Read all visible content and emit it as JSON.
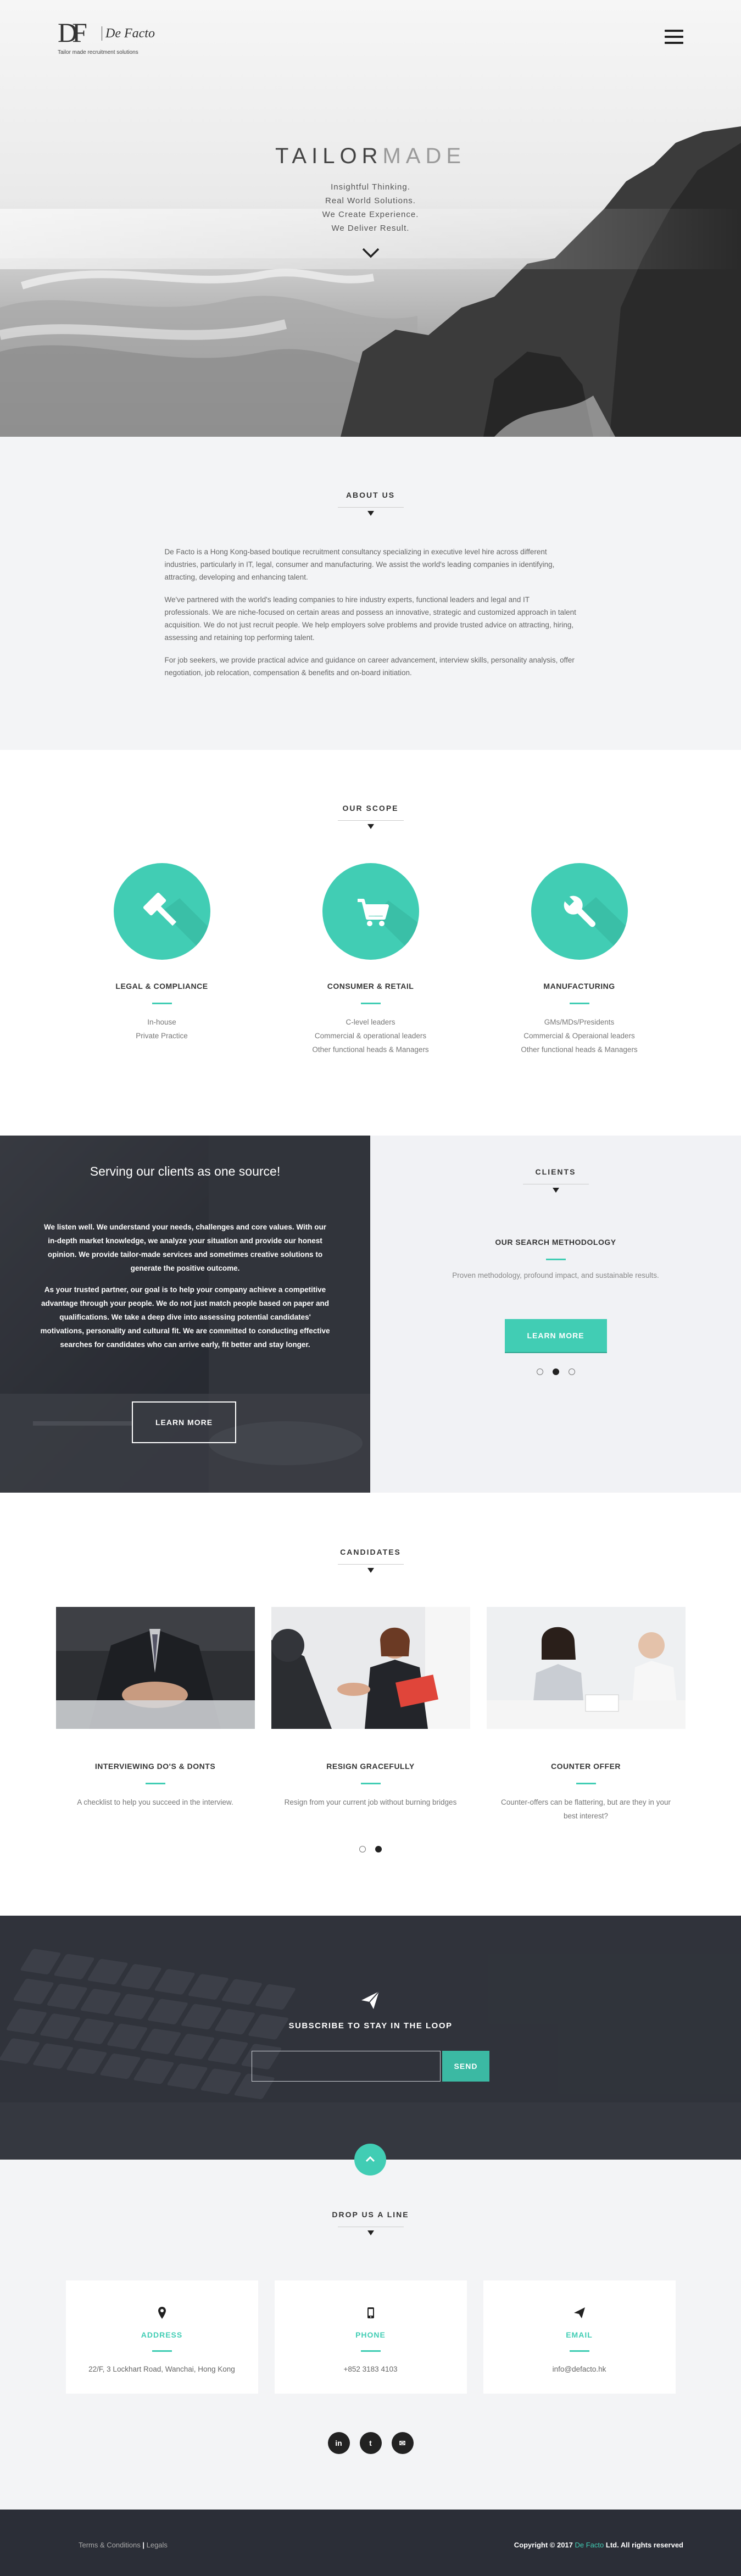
{
  "brand": {
    "mark": "DF",
    "name": "De Facto",
    "tagline": "Tailor made recruitment solutions"
  },
  "hero": {
    "title_part1": "TAILOR",
    "title_part2": "MADE",
    "lines": [
      "Insightful Thinking.",
      "Real World Solutions.",
      "We Create Experience.",
      "We Deliver Result."
    ],
    "menu_icon": "hamburger-icon",
    "scroll_icon": "chevron-down-icon"
  },
  "about": {
    "title": "ABOUT US",
    "paragraphs": [
      "De Facto is a Hong Kong-based boutique recruitment consultancy specializing in executive level hire across different industries, particularly in IT, legal, consumer and manufacturing. We assist the world's leading companies in identifying, attracting, developing and enhancing talent.",
      "We've partnered with the world's leading companies to hire industry experts, functional leaders and legal and IT professionals. We are niche-focused on certain areas and possess an innovative, strategic and customized approach in talent acquisition. We do not just recruit people. We help employers solve problems and provide trusted advice on attracting, hiring, assessing and retaining top performing talent.",
      "For job seekers, we provide practical advice and guidance on career advancement, interview skills, personality analysis, offer negotiation, job relocation, compensation & benefits and on-board initiation."
    ]
  },
  "scope": {
    "title": "OUR SCOPE",
    "items": [
      {
        "icon": "gavel-icon",
        "heading": "LEGAL & COMPLIANCE",
        "lines": [
          "In-house",
          "Private Practice"
        ]
      },
      {
        "icon": "cart-icon",
        "heading": "CONSUMER & RETAIL",
        "lines": [
          "C-level leaders",
          "Commercial & operational leaders",
          "Other functional heads & Managers"
        ]
      },
      {
        "icon": "wrench-icon",
        "heading": "MANUFACTURING",
        "lines": [
          "GMs/MDs/Presidents",
          "Commercial & Operaional leaders",
          "Other functional heads & Managers"
        ]
      }
    ]
  },
  "serving": {
    "title": "Serving our clients as one source!",
    "paragraphs": [
      "We listen well. We understand your needs, challenges and core values. With our in-depth market knowledge, we analyze your situation and provide our honest opinion. We provide tailor-made services and sometimes creative solutions to generate the positive outcome.",
      "As your trusted partner, our goal is to help your company achieve a competitive advantage through your people. We do not just match people based on paper and qualifications. We take a deep dive into assessing potential candidates' motivations, personality and cultural fit. We are committed to conducting effective searches for candidates who can arrive early, fit better and stay longer."
    ],
    "button": "LEARN MORE"
  },
  "clients": {
    "title": "CLIENTS",
    "subtitle": "OUR SEARCH METHODOLOGY",
    "description": "Proven methodology, profound impact, and sustainable results.",
    "button": "LEARN MORE",
    "slides": 3,
    "active_slide": 2
  },
  "candidates": {
    "title": "CANDIDATES",
    "items": [
      {
        "heading": "INTERVIEWING DO'S & DONTS",
        "text": "A checklist to help you succeed in the interview."
      },
      {
        "heading": "RESIGN GRACEFULLY",
        "text": "Resign from your current job without burning bridges"
      },
      {
        "heading": "COUNTER OFFER",
        "text": "Counter-offers can be flattering, but are they in your best interest?"
      }
    ],
    "slides": 2,
    "active_slide": 2
  },
  "subscribe": {
    "icon": "paper-plane-icon",
    "title": "SUBSCRIBE TO STAY IN THE LOOP",
    "input_placeholder": "",
    "button": "SEND",
    "up_icon": "chevron-up-icon"
  },
  "contact": {
    "title": "DROP US A LINE",
    "cards": [
      {
        "icon": "map-marker-icon",
        "heading": "ADDRESS",
        "value": "22/F, 3 Lockhart Road, Wanchai, Hong Kong"
      },
      {
        "icon": "mobile-phone-icon",
        "heading": "PHONE",
        "value": "+852 3183 4103"
      },
      {
        "icon": "paper-plane-icon",
        "heading": "EMAIL",
        "value": "info@defacto.hk"
      }
    ],
    "socials": [
      {
        "icon": "linkedin-icon",
        "glyph": "in"
      },
      {
        "icon": "twitter-icon",
        "glyph": "t"
      },
      {
        "icon": "envelope-icon",
        "glyph": "✉"
      }
    ]
  },
  "footer": {
    "terms": "Terms & Conditions",
    "separator": "|",
    "legals": "Legals",
    "copyright_prefix": "Copyright © 2017",
    "copyright_brand": "De Facto",
    "copyright_suffix": "Ltd. All rights reserved"
  },
  "colors": {
    "accent": "#41cdb4",
    "dark": "#2b2e37",
    "light_bg": "#f3f4f6"
  }
}
